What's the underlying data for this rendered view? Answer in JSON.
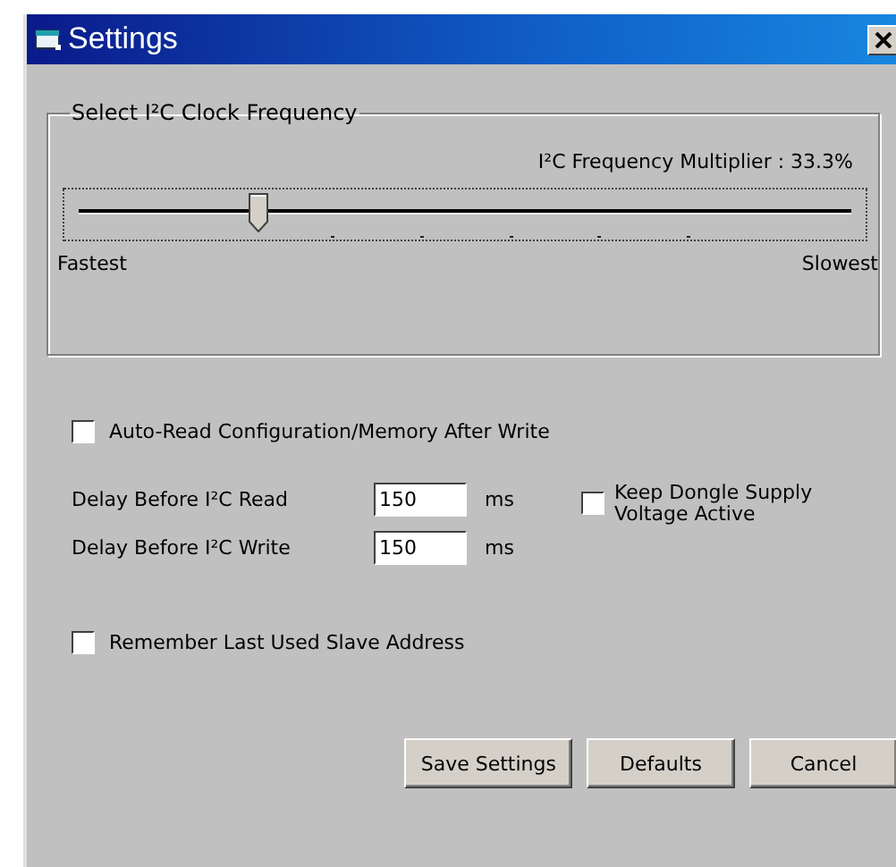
{
  "window": {
    "title": "Settings"
  },
  "clock_group": {
    "title": "Select I²C Clock Frequency",
    "reading": "I²C Frequency Multiplier : 33.3%",
    "level": 0.23,
    "min_label": "Fastest",
    "max_label": "Slowest"
  },
  "auto_read": {
    "label": "Auto-Read Configuration/Memory After Write",
    "checked": false
  },
  "delays": [
    {
      "label": "Delay Before I²C Read",
      "value": "150",
      "unit": "ms"
    },
    {
      "label": "Delay Before I²C Write",
      "value": "150",
      "unit": "ms"
    }
  ],
  "keep_supply": {
    "label": "Keep Dongle Supply Voltage Active",
    "checked": false
  },
  "remember_address": {
    "label": "Remember Last Used Slave Address",
    "checked": false
  },
  "buttons": [
    "Save Settings",
    "Defaults",
    "Cancel"
  ]
}
